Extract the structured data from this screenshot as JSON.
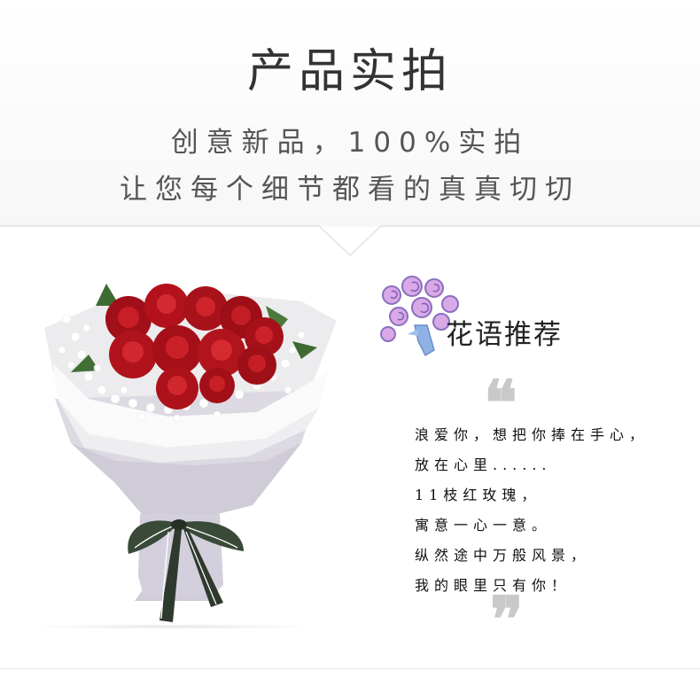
{
  "header": {
    "title": "产品实拍",
    "subtitle_line1": "创意新品，100%实拍",
    "subtitle_line2": "让您每个细节都看的真真切切"
  },
  "recommend": {
    "title": "花语推荐",
    "poem": [
      "浪爱你，想把你捧在手心，",
      "放在心里......",
      "11枝红玫瑰，",
      "寓意一心一意。",
      "纵然途中万般风景，",
      "我的眼里只有你！"
    ]
  },
  "icons": {
    "quote_open": "quote-open-icon",
    "quote_close": "quote-close-icon",
    "logo": "flower-bouquet-logo"
  },
  "colors": {
    "rose": "#b3121c",
    "wrap": "#d8d5df",
    "ribbon_dark": "#2f3a2e",
    "logo_pink": "#d78bd3",
    "logo_blue": "#7fa4d8"
  }
}
